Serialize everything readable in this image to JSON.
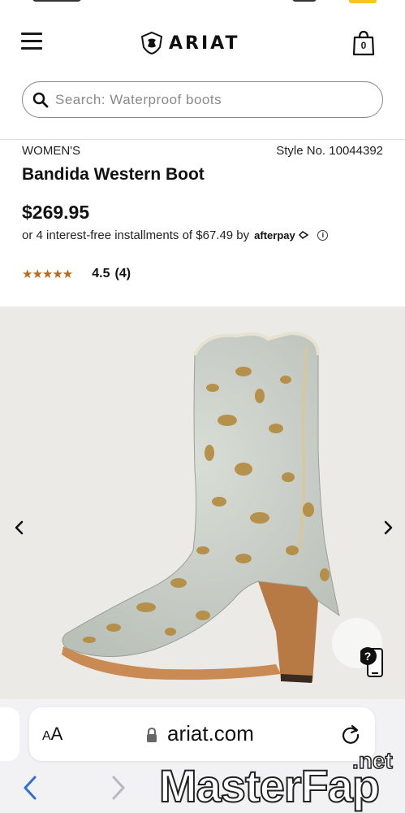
{
  "header": {
    "logo_text": "ARIAT",
    "cart_count": "0",
    "menu_icon": "hamburger-menu-icon",
    "cart_icon": "shopping-bag-icon"
  },
  "search": {
    "placeholder": "Search: Waterproof boots",
    "icon": "search-icon"
  },
  "product": {
    "category": "WOMEN'S",
    "style_number": "Style No. 10044392",
    "title": "Bandida Western Boot",
    "price": "$269.95",
    "installments_text": "or 4 interest-free installments of $67.49 by",
    "installments_provider": "afterpay",
    "rating_stars": "★★★★★",
    "rating_fraction": 0.9,
    "rating_value": "4.5",
    "rating_count": "(4)"
  },
  "gallery": {
    "prev_icon": "chevron-left-icon",
    "next_icon": "chevron-right-icon",
    "help_icon": "question-help-icon"
  },
  "browser": {
    "text_size_label": "AA",
    "domain": "ariat.com",
    "lock_icon": "lock-icon",
    "reload_icon": "reload-icon",
    "back_icon": "back-arrow-icon",
    "forward_icon": "forward-arrow-icon"
  },
  "watermark": {
    "main": "MasterFap",
    "suffix": ".net"
  },
  "colors": {
    "star": "#b86a1f",
    "text": "#1a1a1a",
    "image_bg": "#ebeae6",
    "browser_bg": "#f2f2f4",
    "link_blue": "#2f6fd6"
  }
}
